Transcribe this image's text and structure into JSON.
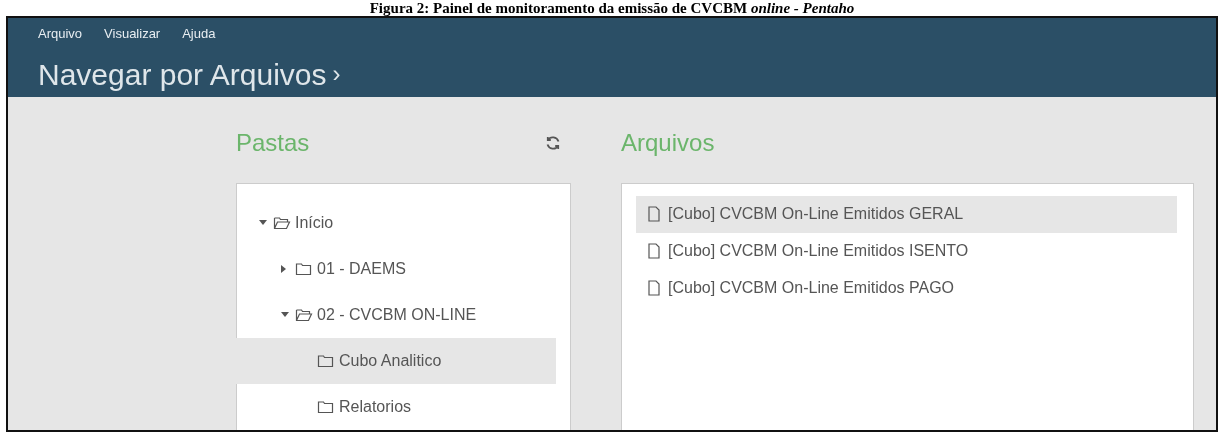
{
  "caption": "Figura 2: Painel de monitoramento da emissão de CVCBM *online - Pentaho*",
  "menu": [
    {
      "label": "Arquivo"
    },
    {
      "label": "Visualizar"
    },
    {
      "label": "Ajuda"
    }
  ],
  "title": "Navegar por Arquivos",
  "title_chevron": "›",
  "folders": {
    "title": "Pastas",
    "tree": [
      {
        "label": "Início",
        "expanded": true,
        "selected": false,
        "children": [
          {
            "label": "01 - DAEMS",
            "expanded": false,
            "selected": false
          },
          {
            "label": "02 - CVCBM ON-LINE",
            "expanded": true,
            "selected": false,
            "children": [
              {
                "label": "Cubo Analitico",
                "selected": true
              },
              {
                "label": "Relatorios",
                "selected": false
              }
            ]
          }
        ]
      }
    ]
  },
  "files": {
    "title": "Arquivos",
    "items": [
      {
        "label": "[Cubo] CVCBM On-Line Emitidos GERAL",
        "selected": true
      },
      {
        "label": "[Cubo] CVCBM On-Line Emitidos ISENTO",
        "selected": false
      },
      {
        "label": "[Cubo] CVCBM On-Line Emitidos PAGO",
        "selected": false
      }
    ]
  }
}
